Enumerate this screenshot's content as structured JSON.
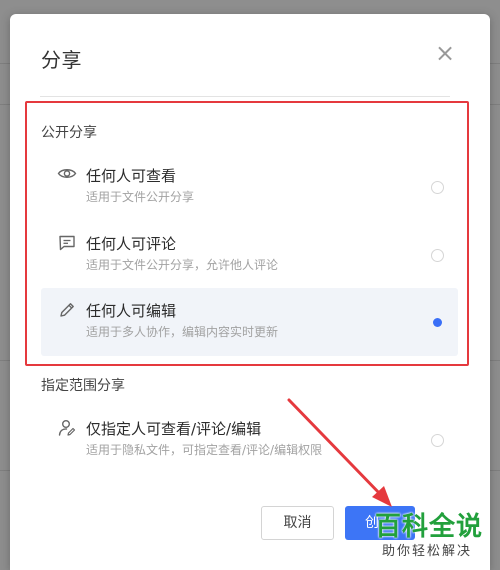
{
  "dialog": {
    "title": "分享",
    "close_glyph": "×"
  },
  "public_section": {
    "label": "公开分享",
    "options": [
      {
        "icon": "eye-icon",
        "title": "任何人可查看",
        "desc": "适用于文件公开分享",
        "selected": false
      },
      {
        "icon": "comment-icon",
        "title": "任何人可评论",
        "desc": "适用于文件公开分享，允许他人评论",
        "selected": false
      },
      {
        "icon": "pencil-icon",
        "title": "任何人可编辑",
        "desc": "适用于多人协作，编辑内容实时更新",
        "selected": true
      }
    ]
  },
  "range_section": {
    "label": "指定范围分享",
    "options": [
      {
        "icon": "user-edit-icon",
        "title": "仅指定人可查看/评论/编辑",
        "desc": "适用于隐私文件，可指定查看/评论/编辑权限",
        "selected": false
      }
    ]
  },
  "footer": {
    "cancel_label": "取消",
    "confirm_label": "创"
  },
  "watermark": {
    "logo": "百科全说",
    "sub": "助你轻松解决"
  },
  "colors": {
    "accent": "#3d75f6",
    "highlight_frame": "#e5393e",
    "arrow": "#e5393e",
    "watermark": "#22a03c"
  }
}
